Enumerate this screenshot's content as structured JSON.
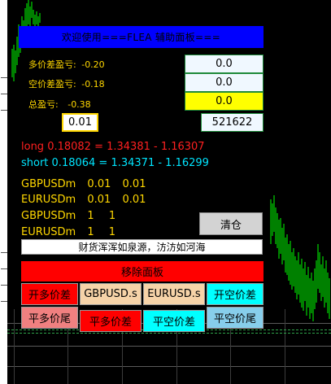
{
  "banner": {
    "title": "欢迎使用===FLEA 辅助面板==="
  },
  "summary": {
    "multi_label": "多价差盈亏:",
    "multi_value": "-0.20",
    "short_label": "空价差盈亏:",
    "short_value": "-0.18",
    "total_label": "总盈亏:",
    "total_value": "-0.38"
  },
  "inputs": {
    "box1": "0.0",
    "box2": "0.0",
    "box3": "0.0",
    "lot": "0.01",
    "magic": "521622"
  },
  "spreads": {
    "long_line": "long  0.18082 = 1.34381 - 1.16307",
    "short_line": "short 0.18064 = 1.34371 - 1.16299"
  },
  "positions": [
    {
      "symbol": "GBPUSDm",
      "a": "0.01",
      "b": "0.01"
    },
    {
      "symbol": "EURUSDm",
      "a": "0.01",
      "b": "0.01"
    },
    {
      "symbol": "GBPUSDm",
      "a": "1",
      "b": "1"
    },
    {
      "symbol": "EURUSDm",
      "a": "1",
      "b": "1"
    }
  ],
  "buttons": {
    "close_all": "清仓",
    "motto": "财货浑浑如泉源，汸汸如河海",
    "remove_panel": "移除面板",
    "open_long": "开多价差",
    "symbol1": "GBPUSD.s",
    "symbol2": "EURUSD.s",
    "open_short": "开空价差",
    "close_long_tail": "平多价尾",
    "close_long": "平多价差",
    "close_short": "平空价差",
    "close_short_tail": "平空价尾"
  },
  "colors": {
    "background": "#000000",
    "banner": "#0000ff",
    "label": "#ffd700",
    "long": "#ff2020",
    "short": "#00e5ff",
    "candle": "#00ff00"
  }
}
